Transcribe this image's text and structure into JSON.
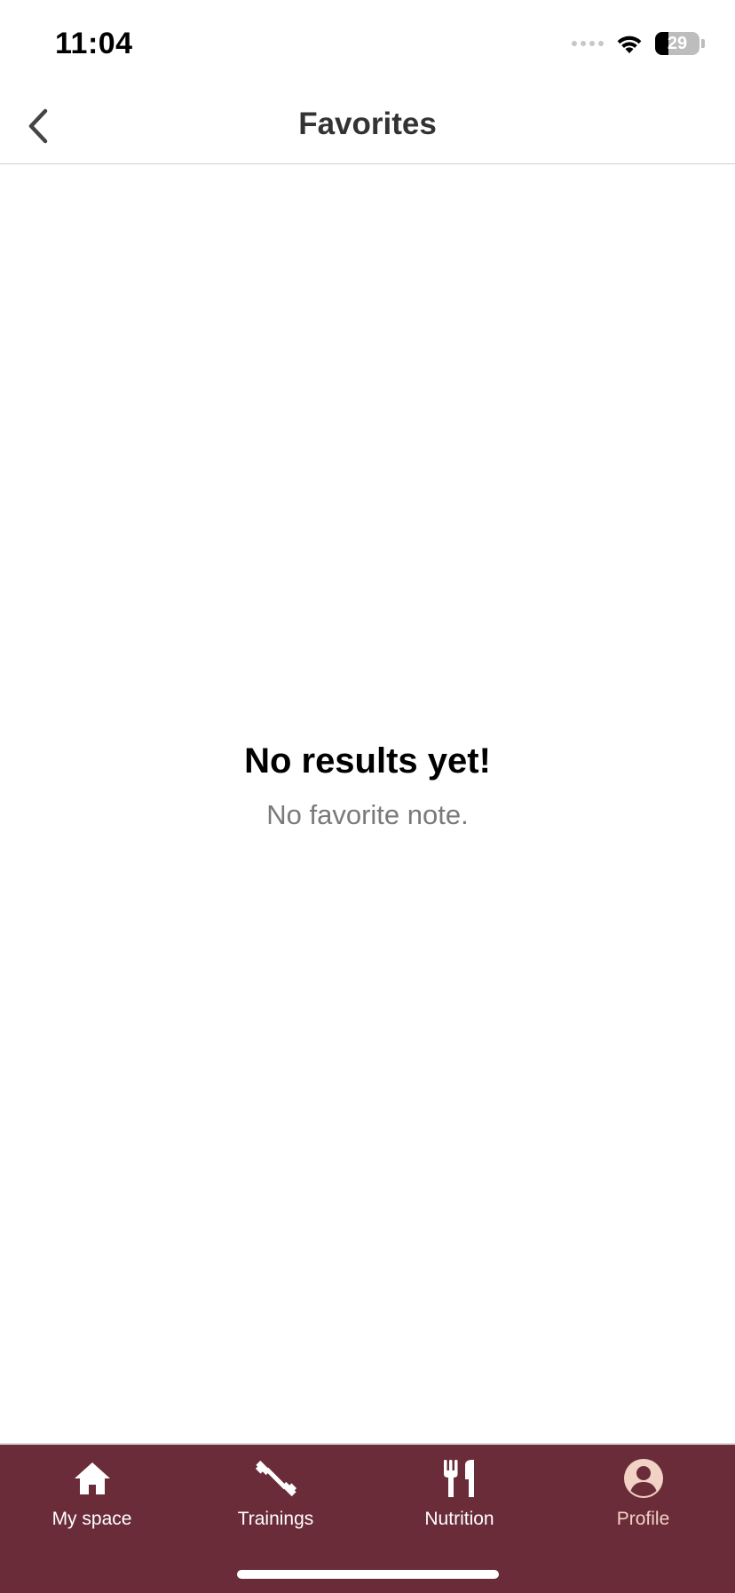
{
  "status_bar": {
    "time": "11:04",
    "battery_level": "29",
    "battery_fraction": 0.29
  },
  "nav": {
    "title": "Favorites",
    "back_icon": "chevron-left-icon"
  },
  "empty_state": {
    "title": "No results yet!",
    "subtitle": "No favorite note."
  },
  "tab_bar": {
    "items": [
      {
        "label": "My space",
        "icon": "home-icon",
        "active": false
      },
      {
        "label": "Trainings",
        "icon": "dumbbell-icon",
        "active": false
      },
      {
        "label": "Nutrition",
        "icon": "fork-knife-icon",
        "active": false
      },
      {
        "label": "Profile",
        "icon": "user-icon",
        "active": true
      }
    ]
  },
  "colors": {
    "tab_bar_background": "#6b2c3a",
    "tab_active": "#f2d2c5",
    "tab_inactive": "#ffffff"
  }
}
